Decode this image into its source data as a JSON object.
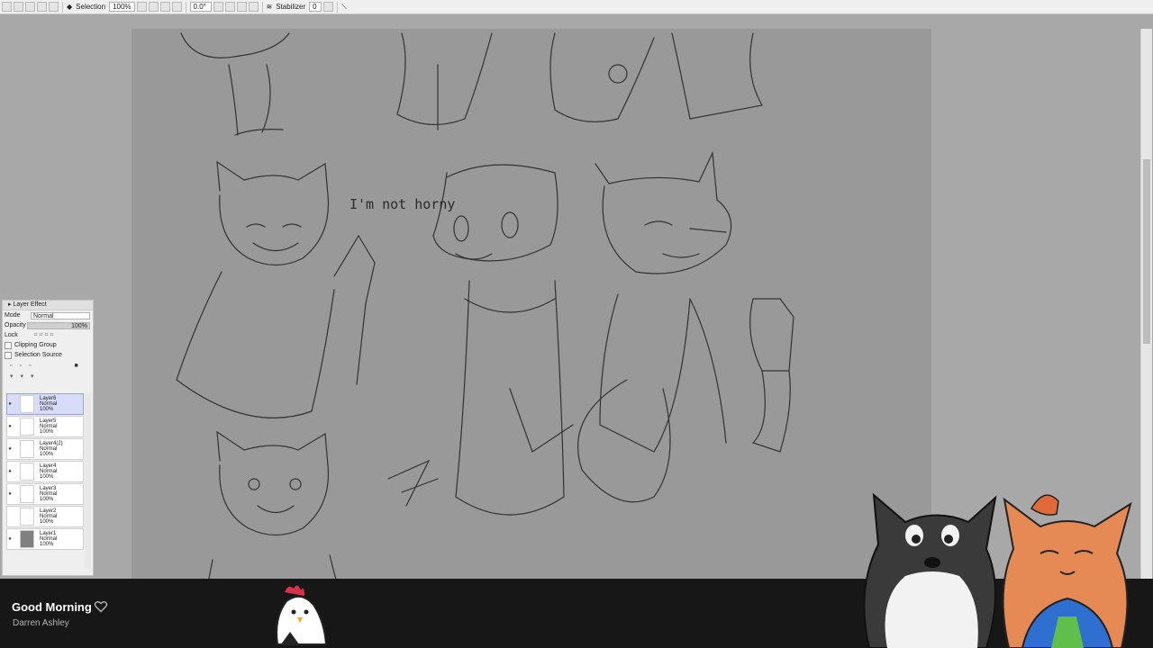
{
  "toolbar": {
    "tool_label": "Selection",
    "zoom": "100%",
    "rotation": "0.0°",
    "stabilizer_label": "Stabilizer",
    "stabilizer_value": "0"
  },
  "canvas": {
    "sketch_text": "I'm not horny"
  },
  "layer_panel": {
    "title": "Layer Effect",
    "mode_label": "Mode",
    "mode_value": "Normal",
    "opacity_label": "Opacity",
    "opacity_value": "100%",
    "lock_label": "Lock",
    "clipping_label": "Clipping Group",
    "selection_label": "Selection Source",
    "layers": [
      {
        "name": "Layer6",
        "mode": "Normal",
        "opacity": "100%"
      },
      {
        "name": "Layer5",
        "mode": "Normal",
        "opacity": "100%"
      },
      {
        "name": "Layer4(2)",
        "mode": "Normal",
        "opacity": "100%"
      },
      {
        "name": "Layer4",
        "mode": "Normal",
        "opacity": "100%"
      },
      {
        "name": "Layer3",
        "mode": "Normal",
        "opacity": "100%"
      },
      {
        "name": "Layer2",
        "mode": "Normal",
        "opacity": "100%"
      },
      {
        "name": "Layer1",
        "mode": "Normal",
        "opacity": "100%"
      }
    ]
  },
  "music": {
    "title": "Good Morning",
    "artist": "Darren Ashley"
  },
  "colors": {
    "canvas": "#999999",
    "workspace": "#a8a8a8",
    "bottombar": "#171717",
    "active_layer": "#d9dcf8"
  },
  "icons": {
    "heart": "heart-icon",
    "visibility": "eye-icon"
  }
}
